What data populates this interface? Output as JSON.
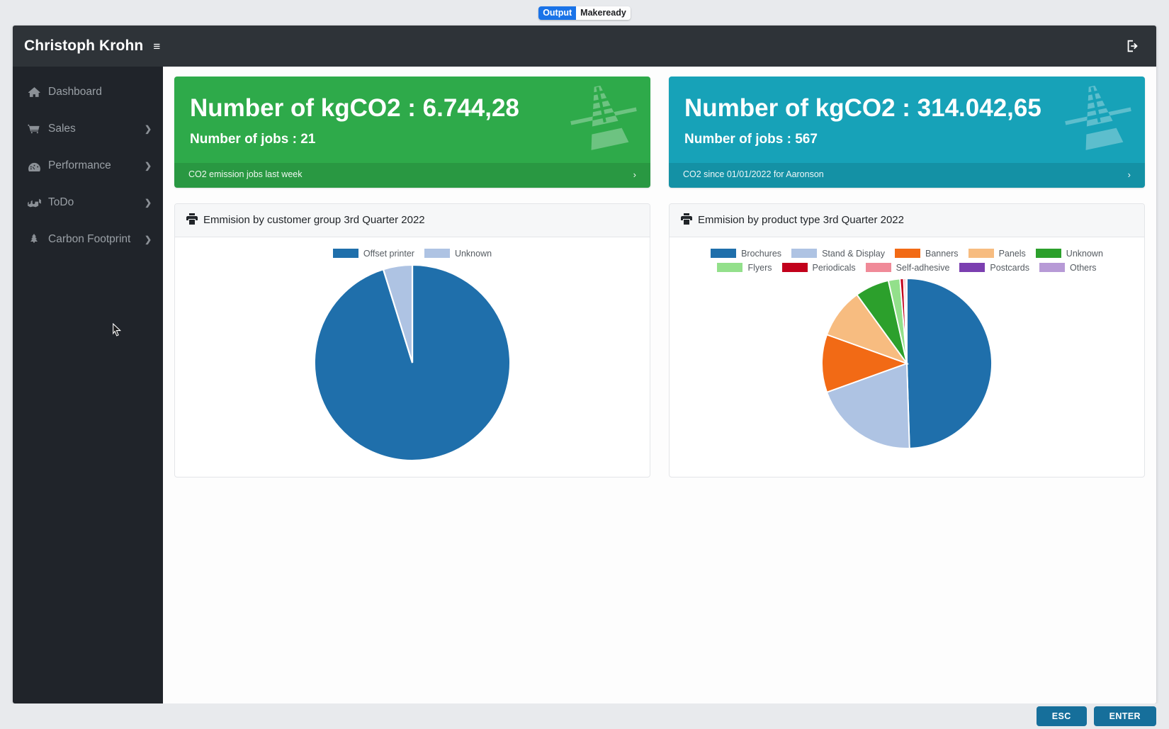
{
  "browser_tabs": [
    {
      "label": "Output",
      "active": true
    },
    {
      "label": "Makeready",
      "active": false
    }
  ],
  "navbar": {
    "brand": "Christoph Krohn",
    "menu_toggle": "≡",
    "logout_title": "logout"
  },
  "sidebar": {
    "items": [
      {
        "label": "Dashboard",
        "icon": "home-icon",
        "has_chevron": false,
        "chevron": "❯"
      },
      {
        "label": "Sales",
        "icon": "cart-icon",
        "has_chevron": true,
        "chevron": "❯"
      },
      {
        "label": "Performance",
        "icon": "tachometer-icon",
        "has_chevron": true,
        "chevron": "❯"
      },
      {
        "label": "ToDo",
        "icon": "hands-helping-icon",
        "has_chevron": true,
        "chevron": "❯"
      },
      {
        "label": "Carbon Footprint",
        "icon": "tree-icon",
        "has_chevron": true,
        "chevron": "❯"
      }
    ]
  },
  "stat_cards": [
    {
      "title": "Number of kgCO2 : 6.744,28",
      "subtitle": "Number of jobs : 21",
      "footer": "CO2 emission jobs last week",
      "footer_arrow": "›",
      "color": "#2eaa4a",
      "icon": "solar-panel-icon"
    },
    {
      "title": "Number of kgCO2 : 314.042,65",
      "subtitle": "Number of jobs : 567",
      "footer": "CO2 since 01/01/2022 for Aaronson",
      "footer_arrow": "›",
      "color": "#17a2b8",
      "icon": "solar-panel-icon"
    }
  ],
  "panels": [
    {
      "title": "Emmision by customer group 3rd Quarter 2022",
      "icon": "printer-icon"
    },
    {
      "title": "Emmision by product type 3rd Quarter 2022",
      "icon": "printer-icon"
    }
  ],
  "chart_data": [
    {
      "type": "pie",
      "title": "Emmision by customer group 3rd Quarter 2022",
      "legend_position": "top",
      "labels": [
        "Offset printer",
        "Unknown"
      ],
      "values": [
        95.2,
        4.8
      ],
      "colors": [
        "#1f6fab",
        "#aec3e3"
      ]
    },
    {
      "type": "pie",
      "title": "Emmision by product type 3rd Quarter 2022",
      "legend_position": "top",
      "labels": [
        "Brochures",
        "Stand & Display",
        "Banners",
        "Panels",
        "Unknown",
        "Flyers",
        "Periodicals",
        "Self-adhesive",
        "Postcards",
        "Others"
      ],
      "values": [
        49.5,
        20.0,
        11.0,
        9.5,
        6.5,
        2.2,
        0.7,
        0.4,
        0.1,
        0.1
      ],
      "colors": [
        "#1f6fab",
        "#aec3e3",
        "#f26a15",
        "#f7bc80",
        "#2ca02c",
        "#93e08b",
        "#c2001b",
        "#f08a98",
        "#7b3fb0",
        "#b79ad6"
      ]
    }
  ],
  "bottom_bar": {
    "esc_label": "ESC",
    "enter_label": "ENTER"
  }
}
